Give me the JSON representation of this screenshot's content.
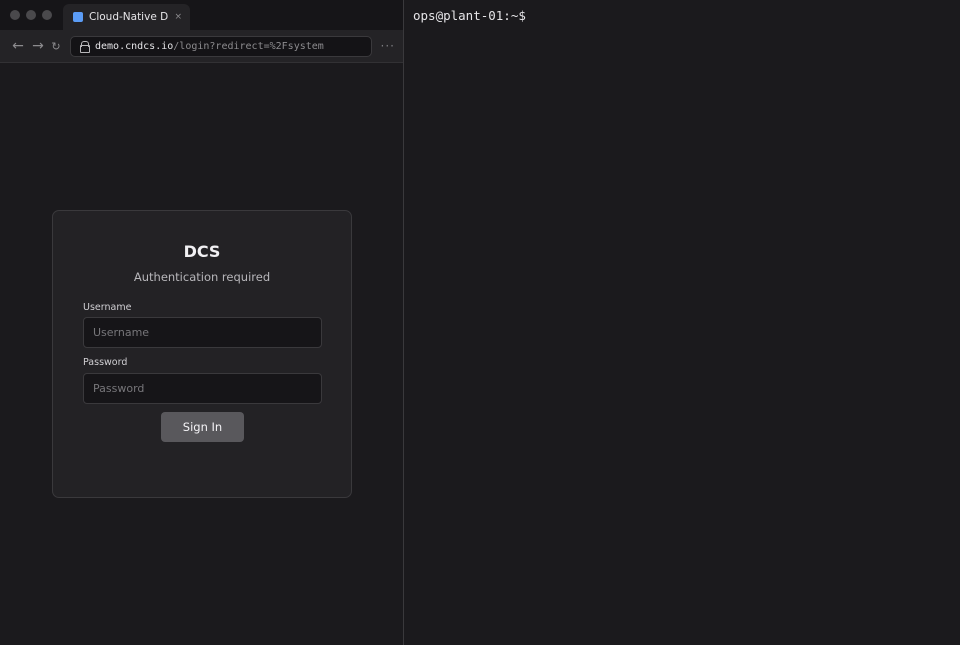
{
  "browser": {
    "tab": {
      "title": "Cloud-Native DCS",
      "close": "×"
    },
    "toolbar": {
      "back": "←",
      "forward": "→",
      "reload": "↻",
      "url_host": "demo.cndcs.io",
      "url_path": "/login?redirect=%2Fsystem",
      "menu": "···"
    }
  },
  "login": {
    "title": "DCS",
    "subtitle": "Authentication required",
    "username_label": "Username",
    "username_value": "",
    "username_placeholder": "Username",
    "password_label": "Password",
    "password_value": "",
    "password_placeholder": "Password",
    "submit_label": "Sign In"
  },
  "terminal": {
    "prompt": "ops@plant-01:~$"
  },
  "colors": {
    "favicon": "#5b9cf6",
    "background": "#1b1a1d",
    "card": "#232225",
    "button": "#59585c"
  }
}
